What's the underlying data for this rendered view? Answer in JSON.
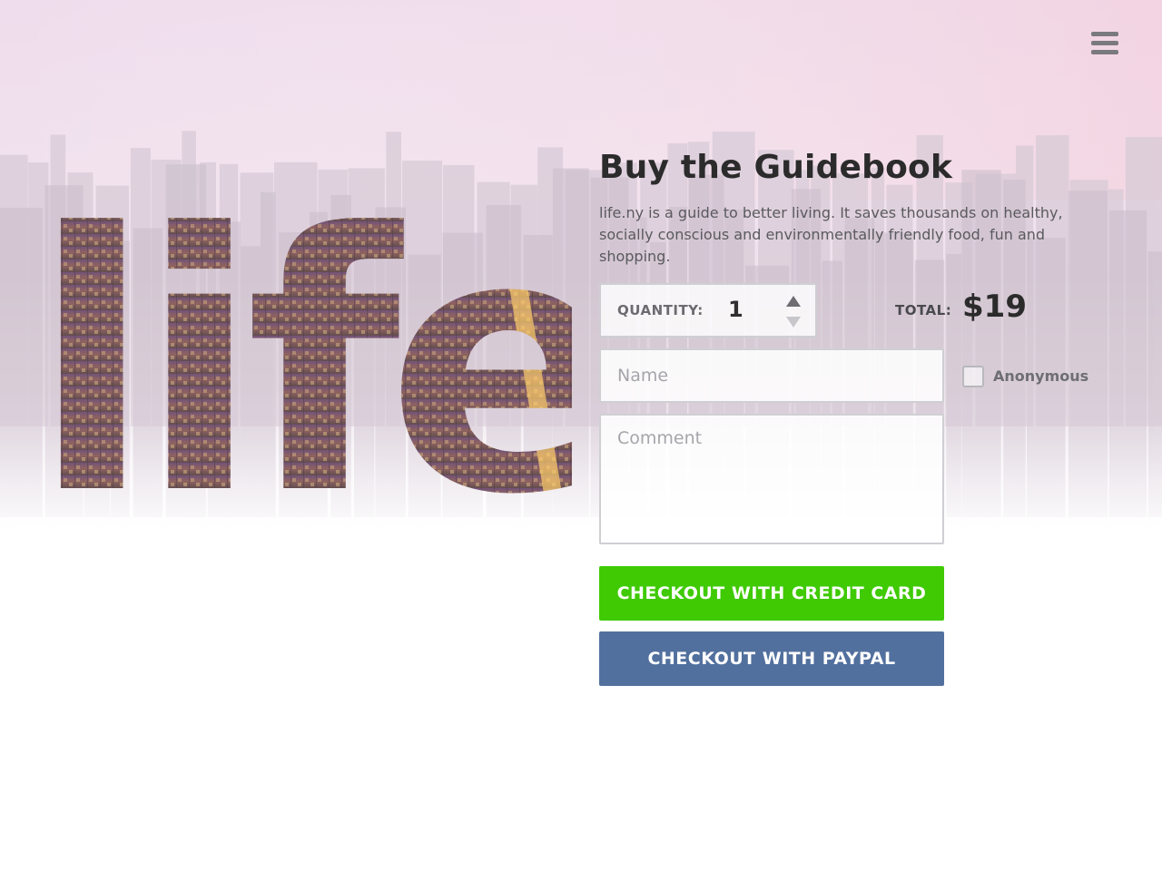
{
  "header": {
    "menu_icon": "hamburger-menu-icon"
  },
  "logo": {
    "text": "life"
  },
  "purchase": {
    "title": "Buy the Guidebook",
    "description": "life.ny is a guide to better living. It saves thousands on healthy, socially conscious and environmentally friendly food, fun and shopping.",
    "quantity": {
      "label": "QUANTITY:",
      "value": "1",
      "up_icon": "triangle-up-icon",
      "down_icon": "triangle-down-icon"
    },
    "total": {
      "label": "TOTAL:",
      "value": "$19"
    },
    "name_field": {
      "placeholder": "Name",
      "value": ""
    },
    "anonymous": {
      "label": "Anonymous",
      "checked": false
    },
    "comment_field": {
      "placeholder": "Comment",
      "value": ""
    },
    "buttons": {
      "credit_card": "CHECKOUT WITH CREDIT CARD",
      "paypal": "CHECKOUT WITH PAYPAL"
    }
  },
  "colors": {
    "credit_card_button": "#3fca04",
    "paypal_button": "#52709e",
    "title_text": "#2b2b2b",
    "sky_top": "#f3e3f0"
  }
}
